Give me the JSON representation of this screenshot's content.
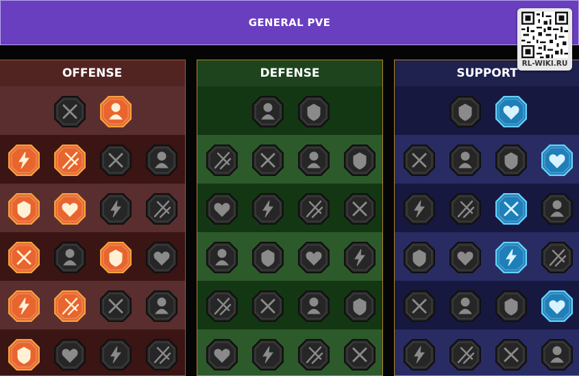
{
  "header": {
    "title": "GENERAL PVE"
  },
  "watermark": {
    "caption": "RL-WIKI.RU"
  },
  "colors": {
    "banner": "#6a3fbf",
    "offense_active": "#e05a2a",
    "support_active": "#3aa7d8",
    "inactive": "#3a3a3a"
  },
  "trees": [
    {
      "id": "offense",
      "title": "OFFENSE",
      "rows": [
        [
          {
            "icon": "crossed-swords-icon",
            "state": "inactive"
          },
          {
            "icon": "sword-strike-icon",
            "state": "active"
          }
        ],
        [
          {
            "icon": "demon-warrior-icon",
            "state": "active"
          },
          {
            "icon": "slashing-blade-icon",
            "state": "active"
          },
          {
            "icon": "shield-sword-icon",
            "state": "inactive"
          },
          {
            "icon": "heart-crush-icon",
            "state": "inactive"
          }
        ],
        [
          {
            "icon": "arrow-volley-icon",
            "state": "active"
          },
          {
            "icon": "fanged-maw-icon",
            "state": "active"
          },
          {
            "icon": "skull-wave-icon",
            "state": "inactive"
          },
          {
            "icon": "axe-hand-icon",
            "state": "inactive"
          }
        ],
        [
          {
            "icon": "sword-blood-icon",
            "state": "active"
          },
          {
            "icon": "gauntlet-fist-icon",
            "state": "inactive"
          },
          {
            "icon": "double-axe-icon",
            "state": "active"
          },
          {
            "icon": "chain-lightning-icon",
            "state": "inactive"
          }
        ],
        [
          {
            "icon": "arrows-fury-icon",
            "state": "active"
          },
          {
            "icon": "twin-skulls-icon",
            "state": "active"
          },
          {
            "icon": "blade-ring-icon",
            "state": "inactive"
          },
          {
            "icon": "warrior-burst-icon",
            "state": "inactive"
          }
        ],
        [
          {
            "icon": "sparkle-sword-icon",
            "state": "active"
          },
          {
            "icon": "knight-helm-icon",
            "state": "inactive"
          },
          {
            "icon": "beast-head-icon",
            "state": "inactive"
          },
          {
            "icon": "skull-crown-icon",
            "state": "inactive"
          }
        ]
      ]
    },
    {
      "id": "defense",
      "title": "DEFENSE",
      "rows": [
        [
          {
            "icon": "brick-wall-icon",
            "state": "inactive"
          },
          {
            "icon": "raised-fist-icon",
            "state": "inactive"
          }
        ],
        [
          {
            "icon": "chevron-shield-icon",
            "state": "inactive"
          },
          {
            "icon": "heart-hand-icon",
            "state": "inactive"
          },
          {
            "icon": "muscle-man-icon",
            "state": "inactive"
          },
          {
            "icon": "blade-parry-icon",
            "state": "inactive"
          }
        ],
        [
          {
            "icon": "dancer-icon",
            "state": "inactive"
          },
          {
            "icon": "knight-shield-icon",
            "state": "inactive"
          },
          {
            "icon": "heart-skull-icon",
            "state": "inactive"
          },
          {
            "icon": "aura-figure-icon",
            "state": "inactive"
          }
        ],
        [
          {
            "icon": "crowd-icon",
            "state": "inactive"
          },
          {
            "icon": "hourglass-icon",
            "state": "inactive"
          },
          {
            "icon": "open-palm-icon",
            "state": "inactive"
          },
          {
            "icon": "bull-head-icon",
            "state": "inactive"
          }
        ],
        [
          {
            "icon": "dash-runner-icon",
            "state": "inactive"
          },
          {
            "icon": "claw-spikes-icon",
            "state": "inactive"
          },
          {
            "icon": "burning-skull-icon",
            "state": "inactive"
          },
          {
            "icon": "block-arm-icon",
            "state": "inactive"
          }
        ],
        [
          {
            "icon": "armored-knight-icon",
            "state": "inactive"
          },
          {
            "icon": "winged-shield-icon",
            "state": "inactive"
          },
          {
            "icon": "bearded-warrior-icon",
            "state": "inactive"
          },
          {
            "icon": "strongman-icon",
            "state": "inactive"
          }
        ]
      ]
    },
    {
      "id": "support",
      "title": "SUPPORT",
      "rows": [
        [
          {
            "icon": "heart-sparkle-icon",
            "state": "inactive"
          },
          {
            "icon": "swirl-shield-icon",
            "state": "active"
          }
        ],
        [
          {
            "icon": "praying-hands-icon",
            "state": "inactive"
          },
          {
            "icon": "ripple-shield-icon",
            "state": "inactive"
          },
          {
            "icon": "flame-skull-icon",
            "state": "inactive"
          },
          {
            "icon": "charging-strike-icon",
            "state": "active"
          }
        ],
        [
          {
            "icon": "sparkle-figure-icon",
            "state": "inactive"
          },
          {
            "icon": "lightning-bolt-icon",
            "state": "inactive"
          },
          {
            "icon": "cracked-ground-icon",
            "state": "active"
          },
          {
            "icon": "twin-figures-icon",
            "state": "inactive"
          }
        ],
        [
          {
            "icon": "chained-heart-icon",
            "state": "inactive"
          },
          {
            "icon": "comet-icon",
            "state": "inactive"
          },
          {
            "icon": "spell-book-icon",
            "state": "active"
          },
          {
            "icon": "angry-face-icon",
            "state": "inactive"
          }
        ],
        [
          {
            "icon": "compass-star-icon",
            "state": "inactive"
          },
          {
            "icon": "fast-boot-icon",
            "state": "inactive"
          },
          {
            "icon": "watching-eye-icon",
            "state": "inactive"
          },
          {
            "icon": "whirlwind-figure-icon",
            "state": "active"
          }
        ],
        [
          {
            "icon": "potion-flask-icon",
            "state": "inactive"
          },
          {
            "icon": "skull-shield-icon",
            "state": "inactive"
          },
          {
            "icon": "grasping-hand-icon",
            "state": "inactive"
          },
          {
            "icon": "eagle-head-icon",
            "state": "inactive"
          }
        ]
      ]
    }
  ]
}
